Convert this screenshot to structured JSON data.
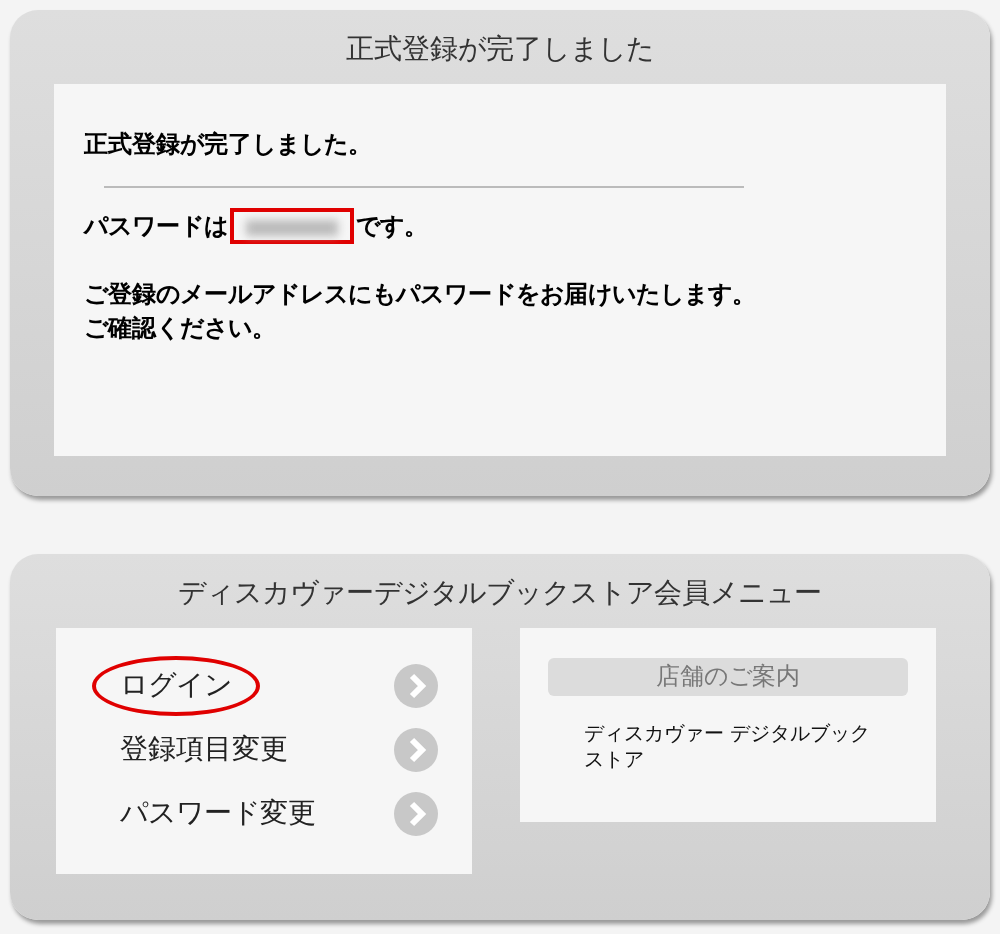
{
  "completion_panel": {
    "title": "正式登録が完了しました",
    "heading": "正式登録が完了しました。",
    "password_line": {
      "before": "パスワードは",
      "redacted": true,
      "highlighted": true,
      "after": "です。"
    },
    "notice": [
      "ご登録のメールアドレスにもパスワードをお届けいたします。",
      "ご確認ください。"
    ]
  },
  "member_menu": {
    "title": "ディスカヴァーデジタルブックストア会員メニュー",
    "items": [
      {
        "label": "ログイン",
        "highlighted": true
      },
      {
        "label": "登録項目変更",
        "highlighted": false
      },
      {
        "label": "パスワード変更",
        "highlighted": false
      }
    ],
    "store_info": {
      "heading": "店舗のご案内",
      "store_name": "ディスカヴァー デジタルブックストア"
    }
  }
}
